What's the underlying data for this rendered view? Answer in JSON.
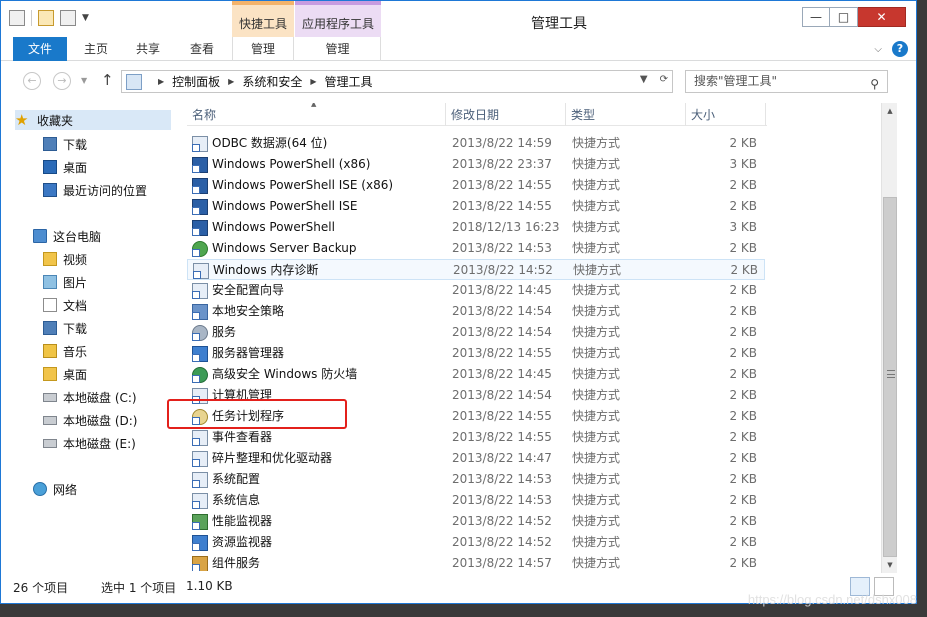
{
  "window": {
    "title": "管理工具",
    "context_tabs": {
      "shortcut_tools": "快捷工具",
      "app_tools": "应用程序工具"
    },
    "controls": {
      "minimize": "—",
      "maximize": "□",
      "close": "✕"
    }
  },
  "ribbon": {
    "tabs": [
      "文件",
      "主页",
      "共享",
      "查看",
      "管理",
      "管理"
    ],
    "help": "?"
  },
  "address": {
    "crumbs": [
      "控制面板",
      "系统和安全",
      "管理工具"
    ],
    "search_placeholder": "搜索\"管理工具\""
  },
  "nav": {
    "favorites": "收藏夹",
    "favorites_items": [
      "下载",
      "桌面",
      "最近访问的位置"
    ],
    "this_pc": "这台电脑",
    "pc_items": [
      "视频",
      "图片",
      "文档",
      "下载",
      "音乐",
      "桌面",
      "本地磁盘 (C:)",
      "本地磁盘 (D:)",
      "本地磁盘 (E:)"
    ],
    "network": "网络"
  },
  "columns": {
    "name": "名称",
    "date": "修改日期",
    "type": "类型",
    "size": "大小"
  },
  "files": [
    {
      "name": "ODBC 数据源(64 位)",
      "date": "2013/8/22 14:59",
      "type": "快捷方式",
      "size": "2 KB",
      "icon": "database-icon"
    },
    {
      "name": "Windows PowerShell (x86)",
      "date": "2013/8/22 23:37",
      "type": "快捷方式",
      "size": "3 KB",
      "icon": "powershell-icon"
    },
    {
      "name": "Windows PowerShell ISE (x86)",
      "date": "2013/8/22 14:55",
      "type": "快捷方式",
      "size": "2 KB",
      "icon": "powershell-icon"
    },
    {
      "name": "Windows PowerShell ISE",
      "date": "2013/8/22 14:55",
      "type": "快捷方式",
      "size": "2 KB",
      "icon": "powershell-icon"
    },
    {
      "name": "Windows PowerShell",
      "date": "2018/12/13 16:23",
      "type": "快捷方式",
      "size": "3 KB",
      "icon": "powershell-icon"
    },
    {
      "name": "Windows Server Backup",
      "date": "2013/8/22 14:53",
      "type": "快捷方式",
      "size": "2 KB",
      "icon": "backup-icon"
    },
    {
      "name": "Windows 内存诊断",
      "date": "2013/8/22 14:52",
      "type": "快捷方式",
      "size": "2 KB",
      "icon": "memory-icon"
    },
    {
      "name": "安全配置向导",
      "date": "2013/8/22 14:45",
      "type": "快捷方式",
      "size": "2 KB",
      "icon": "wizard-icon"
    },
    {
      "name": "本地安全策略",
      "date": "2013/8/22 14:54",
      "type": "快捷方式",
      "size": "2 KB",
      "icon": "security-policy-icon"
    },
    {
      "name": "服务",
      "date": "2013/8/22 14:54",
      "type": "快捷方式",
      "size": "2 KB",
      "icon": "gear-icon"
    },
    {
      "name": "服务器管理器",
      "date": "2013/8/22 14:55",
      "type": "快捷方式",
      "size": "2 KB",
      "icon": "server-manager-icon"
    },
    {
      "name": "高级安全 Windows 防火墙",
      "date": "2013/8/22 14:45",
      "type": "快捷方式",
      "size": "2 KB",
      "icon": "firewall-icon"
    },
    {
      "name": "计算机管理",
      "date": "2013/8/22 14:54",
      "type": "快捷方式",
      "size": "2 KB",
      "icon": "computer-management-icon"
    },
    {
      "name": "任务计划程序",
      "date": "2013/8/22 14:55",
      "type": "快捷方式",
      "size": "2 KB",
      "icon": "clock-icon"
    },
    {
      "name": "事件查看器",
      "date": "2013/8/22 14:55",
      "type": "快捷方式",
      "size": "2 KB",
      "icon": "event-viewer-icon"
    },
    {
      "name": "碎片整理和优化驱动器",
      "date": "2013/8/22 14:47",
      "type": "快捷方式",
      "size": "2 KB",
      "icon": "defrag-icon"
    },
    {
      "name": "系统配置",
      "date": "2013/8/22 14:53",
      "type": "快捷方式",
      "size": "2 KB",
      "icon": "system-config-icon"
    },
    {
      "name": "系统信息",
      "date": "2013/8/22 14:53",
      "type": "快捷方式",
      "size": "2 KB",
      "icon": "system-info-icon"
    },
    {
      "name": "性能监视器",
      "date": "2013/8/22 14:52",
      "type": "快捷方式",
      "size": "2 KB",
      "icon": "performance-icon"
    },
    {
      "name": "资源监视器",
      "date": "2013/8/22 14:52",
      "type": "快捷方式",
      "size": "2 KB",
      "icon": "resource-monitor-icon"
    },
    {
      "name": "组件服务",
      "date": "2013/8/22 14:57",
      "type": "快捷方式",
      "size": "2 KB",
      "icon": "component-services-icon"
    }
  ],
  "status": {
    "count": "26 个项目",
    "selected": "选中 1 个项目",
    "size": "1.10 KB"
  },
  "watermark": "https://blog.csdn.net/dshx008"
}
